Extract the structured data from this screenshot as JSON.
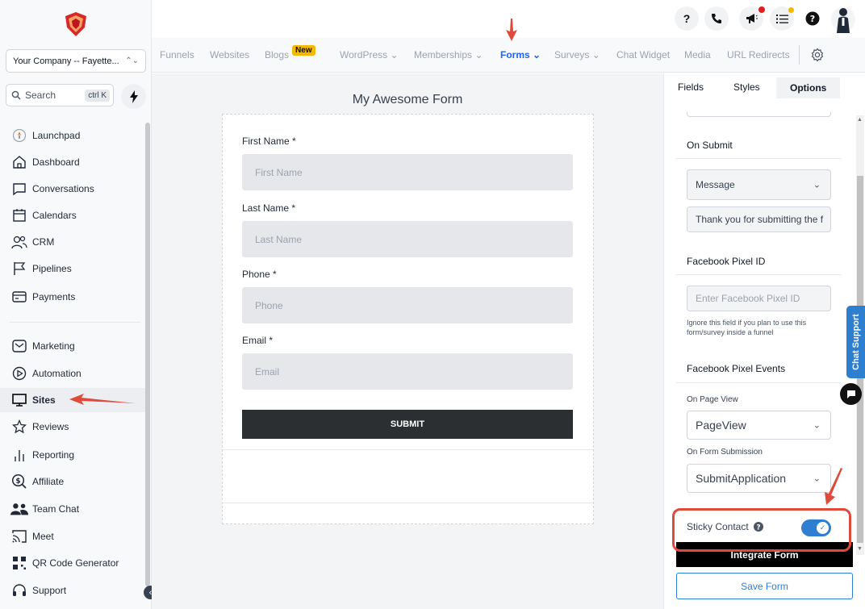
{
  "sidebar": {
    "company": "Your Company -- Fayette...",
    "search_placeholder": "Search",
    "search_shortcut": "ctrl K",
    "items": [
      {
        "label": "Launchpad",
        "icon": "rocket-icon"
      },
      {
        "label": "Dashboard",
        "icon": "home-icon"
      },
      {
        "label": "Conversations",
        "icon": "chat-icon"
      },
      {
        "label": "Calendars",
        "icon": "calendar-icon"
      },
      {
        "label": "CRM",
        "icon": "contacts-icon"
      },
      {
        "label": "Pipelines",
        "icon": "flag-icon"
      },
      {
        "label": "Payments",
        "icon": "payments-icon"
      },
      {
        "label": "Marketing",
        "icon": "mail-icon"
      },
      {
        "label": "Automation",
        "icon": "play-icon"
      },
      {
        "label": "Sites",
        "icon": "monitor-icon"
      },
      {
        "label": "Reviews",
        "icon": "star-icon"
      },
      {
        "label": "Reporting",
        "icon": "bars-icon"
      },
      {
        "label": "Affiliate",
        "icon": "dollar-icon"
      },
      {
        "label": "Team Chat",
        "icon": "team-icon"
      },
      {
        "label": "Meet",
        "icon": "cast-icon"
      },
      {
        "label": "QR Code Generator",
        "icon": "qr-icon"
      },
      {
        "label": "Support",
        "icon": "headset-icon"
      }
    ],
    "active_item": "Sites"
  },
  "header": {
    "help_glyph": "?",
    "icons": [
      "help-icon",
      "phone-icon",
      "megaphone-icon",
      "list-icon",
      "question-icon",
      "avatar"
    ]
  },
  "subnav": {
    "tabs": [
      "Funnels",
      "Websites",
      "Blogs",
      "WordPress",
      "Memberships",
      "Forms",
      "Surveys",
      "Chat Widget",
      "Media",
      "URL Redirects"
    ],
    "new_badge": "New",
    "active_tab": "Forms"
  },
  "form": {
    "title": "My Awesome Form",
    "fields": [
      {
        "label": "First Name *",
        "placeholder": "First Name"
      },
      {
        "label": "Last Name *",
        "placeholder": "Last Name"
      },
      {
        "label": "Phone *",
        "placeholder": "Phone"
      },
      {
        "label": "Email *",
        "placeholder": "Email"
      }
    ],
    "submit_label": "SUBMIT"
  },
  "panel": {
    "tabs": [
      "Fields",
      "Styles",
      "Options"
    ],
    "active_tab": "Options",
    "on_submit_label": "On Submit",
    "on_submit_value": "Message",
    "message_value": "Thank you for submitting the f",
    "pixel_id_label": "Facebook Pixel ID",
    "pixel_id_placeholder": "Enter Facebook Pixel ID",
    "pixel_hint": "Ignore this field if you plan to use this form/survey inside a funnel",
    "pixel_events_label": "Facebook Pixel Events",
    "page_view_label": "On Page View",
    "page_view_value": "PageView",
    "form_submission_label": "On Form Submission",
    "form_submission_value": "SubmitApplication",
    "sticky_contact_label": "Sticky Contact",
    "sticky_contact_on": true,
    "integrate_label": "Integrate Form",
    "save_label": "Save Form"
  },
  "chat_support_label": "Chat Support",
  "colors": {
    "accent": "#2f7fd1",
    "annotation": "#e04a3a",
    "new_badge": "#f5b800",
    "notification_red": "#e11d1d",
    "notification_yellow": "#f5b800"
  }
}
